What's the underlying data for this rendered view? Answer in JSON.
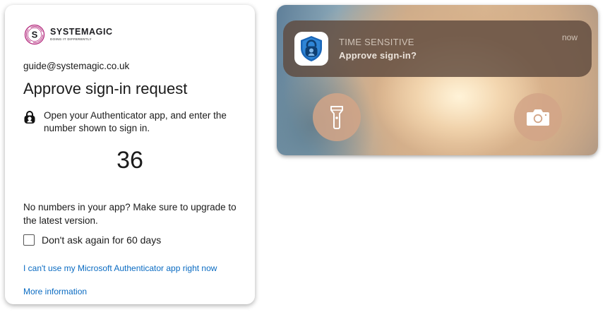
{
  "card": {
    "logo": {
      "name": "SYSTEMAGIC",
      "tagline": "DOING IT DIFFERENTLY",
      "mark_letter": "S"
    },
    "email": "guide@systemagic.co.uk",
    "title": "Approve sign-in request",
    "instruction": "Open your Authenticator app, and enter the number shown to sign in.",
    "number": "36",
    "no_numbers_text": "No numbers in your app? Make sure to upgrade to the latest version.",
    "dont_ask_label": "Don't ask again for 60 days",
    "dont_ask_checked": false,
    "link_cant_use": "I can't use my Microsoft Authenticator app right now",
    "link_more_info": "More information",
    "colors": {
      "link": "#0a6bc2",
      "logo_accent": "#b2257a"
    }
  },
  "phone": {
    "notification": {
      "title": "TIME SENSITIVE",
      "body": "Approve sign-in?",
      "time": "now",
      "app_icon": "authenticator-icon"
    },
    "flashlight_icon": "flashlight-icon",
    "camera_icon": "camera-icon"
  }
}
